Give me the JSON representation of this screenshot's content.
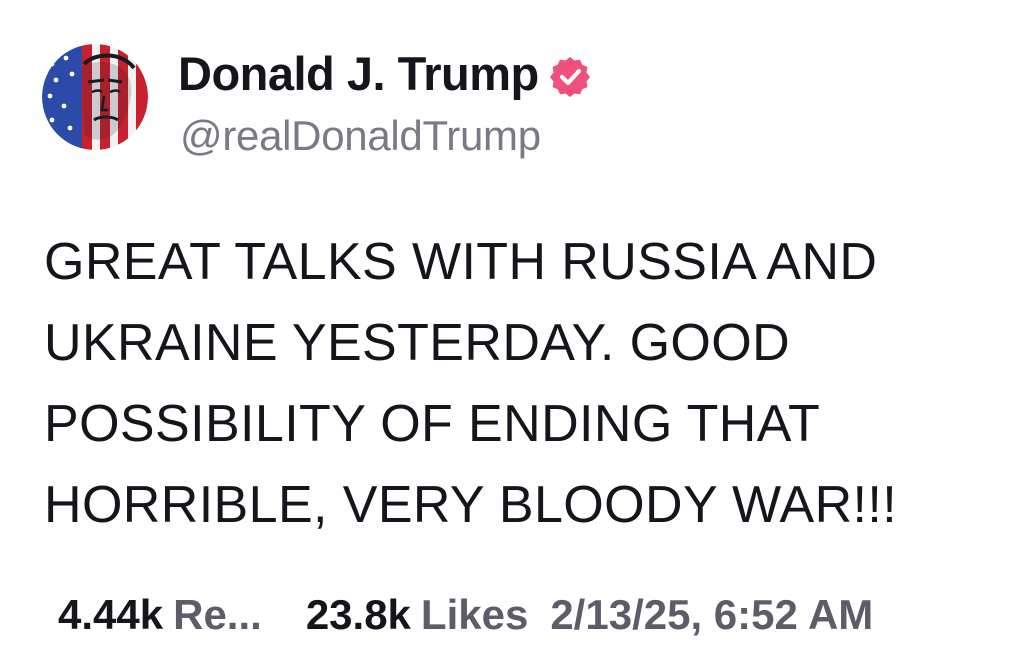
{
  "author": {
    "display_name": "Donald J. Trump",
    "handle": "@realDonaldTrump",
    "verified": true,
    "verified_badge_color": "#f0507c",
    "avatar_icon": "stars-and-stripes-portrait"
  },
  "post": {
    "lines": [
      "GREAT TALKS WITH RUSSIA AND",
      "UKRAINE YESTERDAY. GOOD",
      "POSSIBILITY OF ENDING THAT",
      "HORRIBLE, VERY BLOODY WAR!!!"
    ]
  },
  "stats": {
    "reposts_count": "4.44k",
    "reposts_label": "Re...",
    "likes_count": "23.8k",
    "likes_label": "Likes",
    "timestamp": "2/13/25, 6:52 AM"
  }
}
